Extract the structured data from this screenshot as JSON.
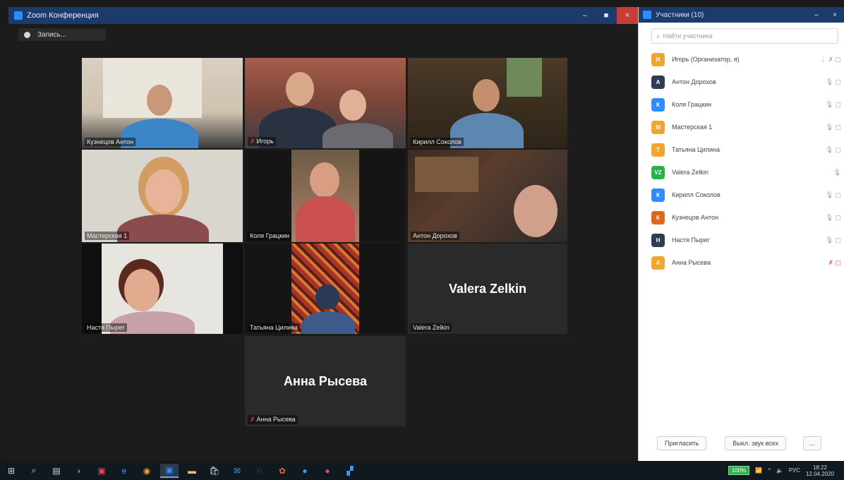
{
  "window": {
    "title": "Zoom Конференция",
    "minimize": "–",
    "maximize": "■",
    "close": "×"
  },
  "recording": {
    "label": "Запись..."
  },
  "tiles": [
    {
      "name": "Кузнецов Антон"
    },
    {
      "name": "Игорь"
    },
    {
      "name": "Кирилл Соколов"
    },
    {
      "name": "Мастерская 1"
    },
    {
      "name": "Коля Грацкин"
    },
    {
      "name": "Антон Дорохов"
    },
    {
      "name": "Настя Пырег"
    },
    {
      "name": "Татьяна Цилина"
    },
    {
      "name": "Valera Zelkin",
      "big": "Valera Zelkin"
    },
    {
      "name": "Анна Рысева",
      "big": "Анна Рысева"
    }
  ],
  "participants_panel": {
    "title": "Участники (10)",
    "search_placeholder": "Найти участника",
    "items": [
      {
        "initial": "И",
        "name": "Игорь (Организатор, я)",
        "color": "#f3a42b",
        "icons": "⋮ ✗ ▢"
      },
      {
        "initial": "А",
        "name": "Антон Дорохов",
        "color": "#2f3d52",
        "icons": "🎙 ▢"
      },
      {
        "initial": "К",
        "name": "Коля Грацкин",
        "color": "#2d8cff",
        "icons": "🎙 ▢"
      },
      {
        "initial": "М",
        "name": "Мастерская 1",
        "color": "#f3a42b",
        "icons": "🎙 ▢"
      },
      {
        "initial": "Т",
        "name": "Татьяна Цилина",
        "color": "#f3a42b",
        "icons": "🎙 ▢"
      },
      {
        "initial": "VZ",
        "name": "Valera Zelkin",
        "color": "#27b34a",
        "icons": "🎙"
      },
      {
        "initial": "К",
        "name": "Кирилл Соколов",
        "color": "#2d8cff",
        "icons": "🎙 ▢"
      },
      {
        "initial": "К",
        "name": "Кузнецов Антон",
        "color": "#e0661f",
        "icons": "🎙 ▢"
      },
      {
        "initial": "Н",
        "name": "Настя Пырег",
        "color": "#2f3d52",
        "icons": "🎙 ▢"
      },
      {
        "initial": "А",
        "name": "Анна Рысева",
        "color": "#f3a42b",
        "icons": "✗ ▢"
      }
    ],
    "invite_button": "Пригласить",
    "mute_all_button": "Выкл. звук всех",
    "more_button": "..."
  },
  "taskbar": {
    "battery": "100%",
    "lang": "РУС",
    "time": "18:22",
    "date": "12.04.2020"
  }
}
